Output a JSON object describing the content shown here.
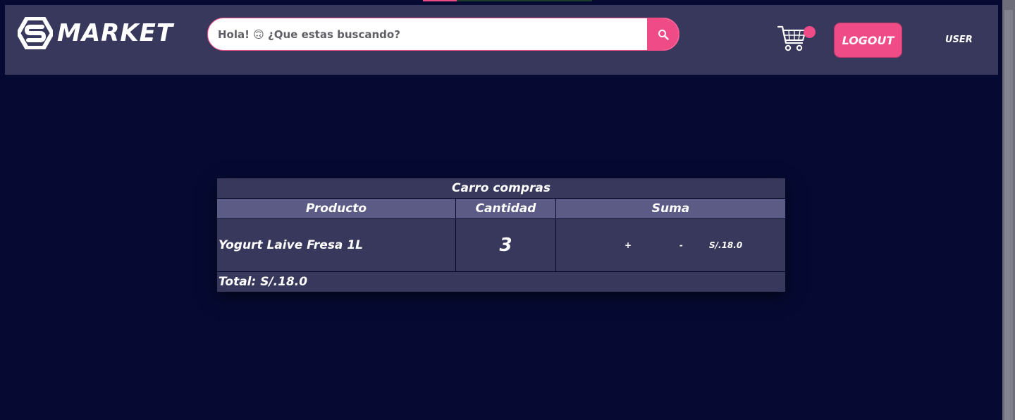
{
  "header": {
    "brand": "MARKET",
    "search": {
      "placeholder": "Hola! 🙃 ¿Que estas buscando?",
      "value": ""
    },
    "logout_label": "LOGOUT",
    "user_label": "USER"
  },
  "cart_table": {
    "title": "Carro compras",
    "columns": [
      "Producto",
      "Cantidad",
      "Suma"
    ],
    "rows": [
      {
        "product": "Yogurt Laive Fresa 1L",
        "quantity": "3",
        "plus_label": "+",
        "minus_label": "-",
        "sum": "S/.18.0"
      }
    ],
    "total_label": "Total: S/.18.0"
  },
  "colors": {
    "background": "#060a33",
    "navbar": "#38385c",
    "accent": "#ef4b87",
    "table_header": "#5b5b86"
  },
  "icons": [
    "market-logo-icon",
    "search-icon",
    "cart-icon"
  ]
}
